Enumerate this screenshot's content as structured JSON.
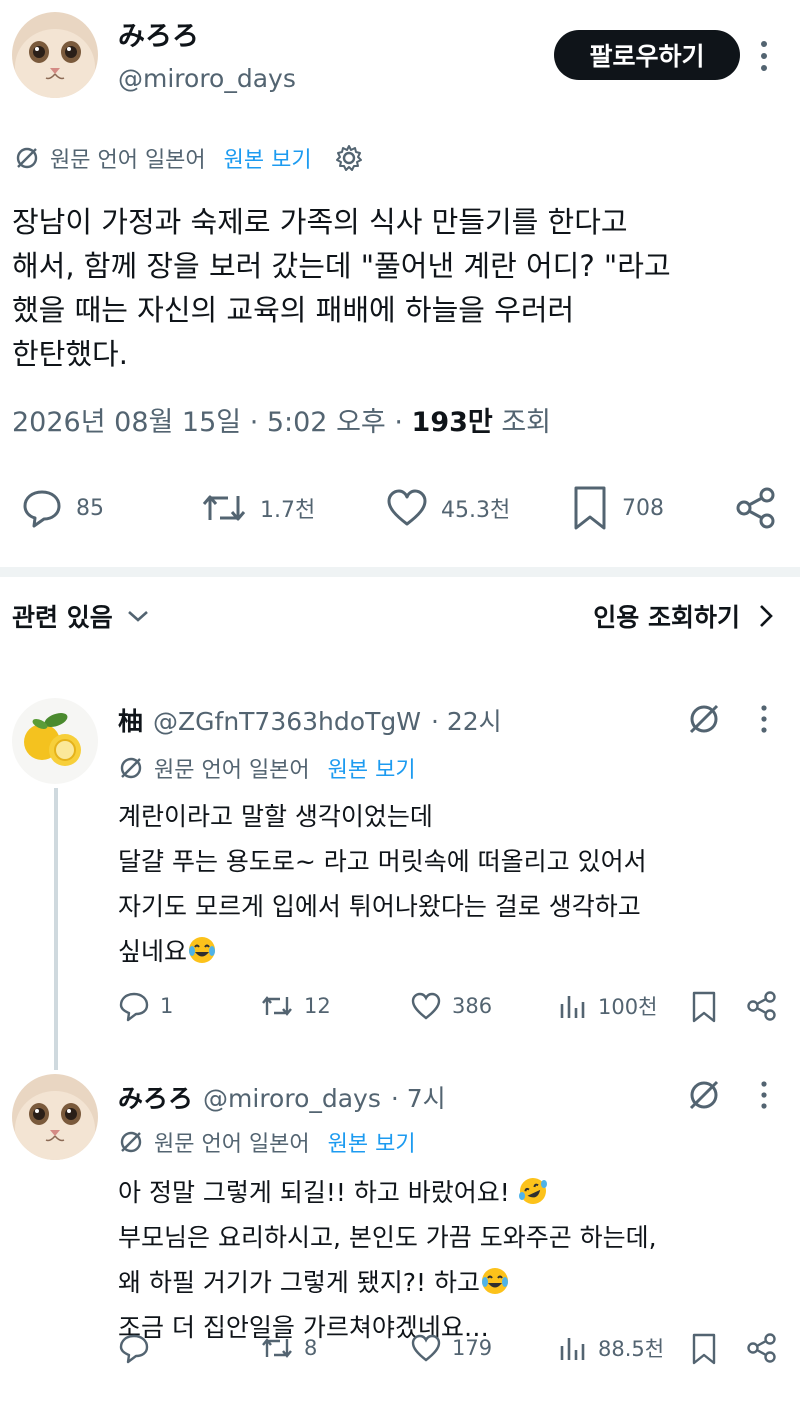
{
  "main_tweet": {
    "author_name": "みろろ",
    "author_handle": "@miroro_days",
    "follow_label": "팔로우하기",
    "translation": {
      "label": "원문 언어 일본어",
      "view_original": "원본 보기"
    },
    "text_lines": [
      "장남이 가정과 숙제로 가족의 식사 만들기를 한다고",
      "해서, 함께 장을 보러 갔는데 \"풀어낸 계란 어디? \"라고",
      "했을 때는 자신의 교육의 패배에 하늘을 우러러",
      "한탄했다."
    ],
    "date_time": "2026년 08월 15일 · 5:02 오후",
    "views_count": "193만",
    "views_label": "조회",
    "stats": {
      "replies": "85",
      "reposts": "1.7천",
      "likes": "45.3천",
      "bookmarks": "708"
    }
  },
  "related_label": "관련 있음",
  "quote_views_label": "인용 조회하기",
  "replies": [
    {
      "author_name": "柚",
      "author_handle": "@ZGfnT7363hdoTgW",
      "time": "· 22시",
      "translation_label": "원문 언어 일본어",
      "view_original": "원본 보기",
      "text_lines": [
        "계란이라고 말할 생각이었는데",
        "달걀 푸는 용도로~ 라고 머릿속에 떠올리고 있어서",
        "자기도 모르게 입에서 튀어나왔다는 걸로 생각하고",
        "싶네요"
      ],
      "stats": {
        "replies": "1",
        "reposts": "12",
        "likes": "386",
        "views": "100천"
      }
    },
    {
      "author_name": "みろろ",
      "author_handle": "@miroro_days",
      "time": "· 7시",
      "translation_label": "원문 언어 일본어",
      "view_original": "원본 보기",
      "text_lines": [
        "아 정말 그렇게 되길!! 하고 바랐어요!",
        "부모님은 요리하시고, 본인도 가끔 도와주곤 하는데,",
        "왜 하필 거기가 그렇게 됐지?! 하고",
        "조금 더 집안일을 가르쳐야겠네요…"
      ],
      "stats": {
        "replies": "",
        "reposts": "8",
        "likes": "179",
        "views": "88.5천"
      }
    }
  ],
  "colors": {
    "text": "#0f1419",
    "muted": "#536471",
    "link": "#1d9bf0",
    "divider": "#eff3f4"
  }
}
